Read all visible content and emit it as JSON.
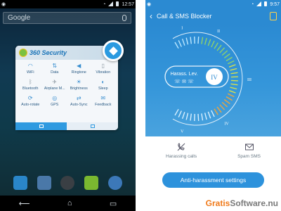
{
  "left_phone": {
    "status": {
      "time": "12:57"
    },
    "search": {
      "placeholder": "Google"
    },
    "widget": {
      "title": "360 Security",
      "toggles": [
        {
          "label": "WiFi",
          "icon": "wifi-icon",
          "active": true
        },
        {
          "label": "Data",
          "icon": "data-arrows-icon",
          "active": true
        },
        {
          "label": "Ringtone",
          "icon": "speaker-icon",
          "active": true
        },
        {
          "label": "Vibration",
          "icon": "vibration-icon",
          "active": false
        },
        {
          "label": "Bluetooth",
          "icon": "bluetooth-icon",
          "active": false
        },
        {
          "label": "Airplane M...",
          "icon": "airplane-icon",
          "active": false
        },
        {
          "label": "Brightness",
          "icon": "brightness-icon",
          "active": true
        },
        {
          "label": "Sleep",
          "icon": "sleep-icon",
          "active": true
        },
        {
          "label": "Auto-rotate",
          "icon": "rotate-icon",
          "active": true
        },
        {
          "label": "GPS",
          "icon": "gps-icon",
          "active": true
        },
        {
          "label": "Auto-Sync",
          "icon": "sync-icon",
          "active": true
        },
        {
          "label": "Feedback",
          "icon": "feedback-icon",
          "active": true
        }
      ]
    }
  },
  "right_phone": {
    "status": {
      "time": "9:57"
    },
    "appbar": {
      "title": "Call & SMS Blocker"
    },
    "gauge": {
      "center_label": "Harass. Lev.",
      "level": "IV",
      "marks": [
        "I",
        "II",
        "III",
        "IV",
        "V"
      ]
    },
    "shortcuts": [
      {
        "label": "Harassing calls",
        "icon": "phone-block-icon"
      },
      {
        "label": "Spam SMS",
        "icon": "mail-block-icon"
      }
    ],
    "cta_label": "Anti-harassment settings"
  },
  "watermark": {
    "prefix": "Gratis",
    "suffix": "Software.nu"
  },
  "colors": {
    "accent": "#2b8ad2",
    "widget_blue": "#3a8fd0",
    "watermark_orange": "#f07a1a",
    "watermark_grey": "#7a7a7a"
  }
}
